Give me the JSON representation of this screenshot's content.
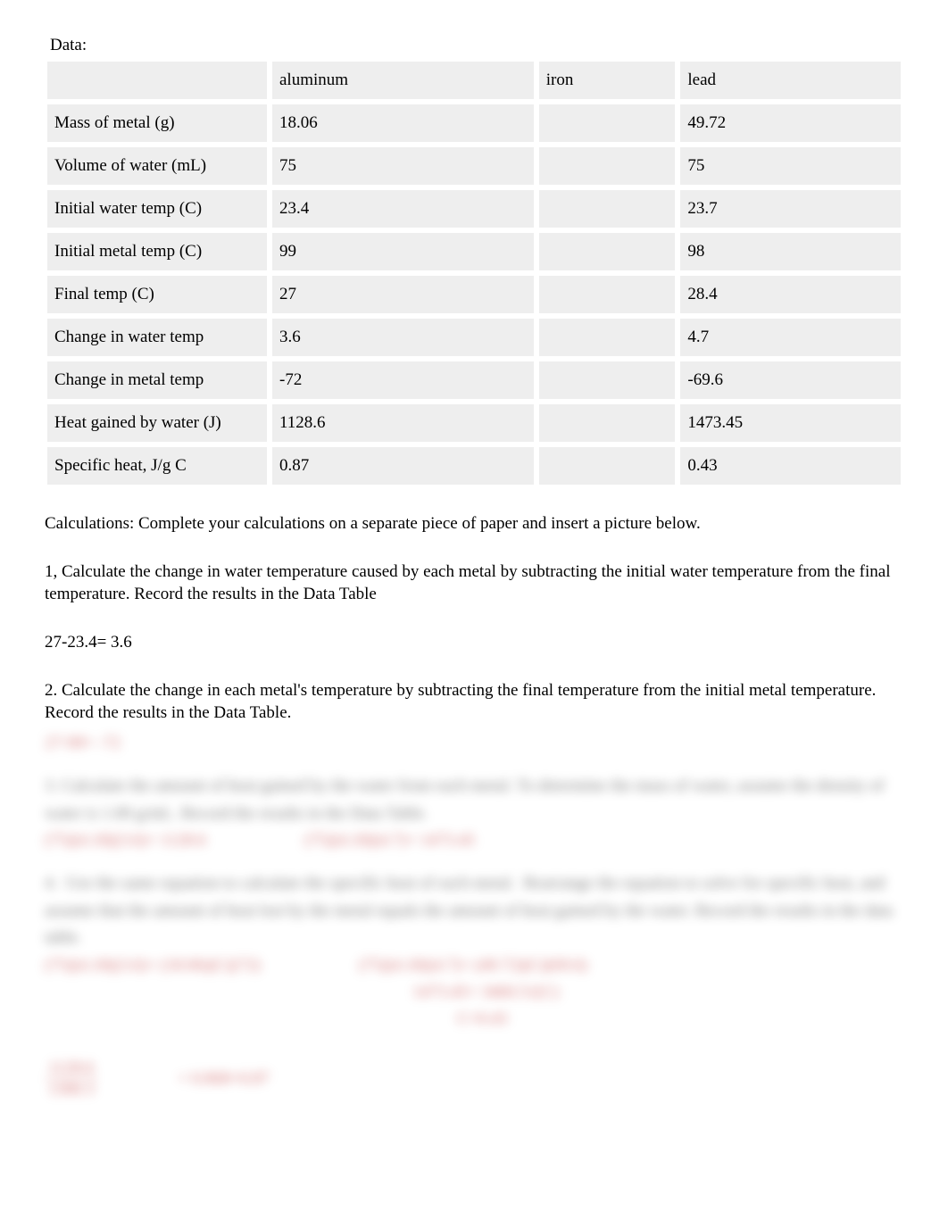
{
  "labels": {
    "data_heading": "Data:",
    "calc_intro": "Calculations: Complete your calculations on a separate piece of paper and insert a picture below.",
    "q1": "1, Calculate the change in water temperature caused by each metal by subtracting the initial water temperature from the final temperature. Record the results in the Data Table",
    "q1_answer": "27-23.4= 3.6",
    "q2": "2. Calculate the change in each metal's temperature by subtracting the final temperature from the initial metal temperature. Record the results in the Data Table."
  },
  "table": {
    "headers": {
      "blank": "",
      "aluminum": "aluminum",
      "iron": "iron",
      "lead": "lead"
    },
    "rows": [
      {
        "label": "Mass of metal (g)",
        "aluminum": "18.06",
        "iron": "",
        "lead": "49.72"
      },
      {
        "label": "Volume of water (mL)",
        "aluminum": "75",
        "iron": "",
        "lead": "75"
      },
      {
        "label": "Initial water temp (C)",
        "aluminum": "23.4",
        "iron": "",
        "lead": "23.7"
      },
      {
        "label": "Initial metal temp (C)",
        "aluminum": "99",
        "iron": "",
        "lead": "98"
      },
      {
        "label": "Final temp (C)",
        "aluminum": "27",
        "iron": "",
        "lead": "28.4"
      },
      {
        "label": "Change in water temp",
        "aluminum": "3.6",
        "iron": "",
        "lead": "4.7"
      },
      {
        "label": "Change in metal temp",
        "aluminum": "-72",
        "iron": "",
        "lead": "-69.6"
      },
      {
        "label": "Heat gained by water (J)",
        "aluminum": "1128.6",
        "iron": "",
        "lead": "1473.45"
      },
      {
        "label": "Specific heat, J/g C",
        "aluminum": "0.87",
        "iron": "",
        "lead": "0.43"
      }
    ]
  },
  "blurred": {
    "line_under_q2": "27-99= -72",
    "q3": "3. Calculate the amount of heat gained by the water from each metal. To determine the mass of water, assume the density of water is 1.00 g/mL. Record the results in the Data Table.",
    "q3_ans_left": "(75)(4.18)(3.6)= 1128.6",
    "q3_ans_right": "(75)(4.18)(4.7)= 1473.45",
    "q4": "4.  Use the same equation to calculate the specific heat of each metal.  Rearrange the equation to solve for specific heat, and assume that the amount of heat lost by the metal equals the amount of heat gained by the water. Record the results in the data table.",
    "q4_left": "(75)(4.18)(3.6)= (18.06)(C)(72)",
    "q4_right_a": "(75)(4.18)(4.7)= (49.72)(C)(69.6)",
    "q4_right_b": "1473.45= 3460.51(C)",
    "q4_right_c": "C=0.43",
    "q4_frac_top": "1128.6",
    "q4_frac_bot": "1300.3",
    "q4_frac_eq": "= 0.868=0.87"
  }
}
